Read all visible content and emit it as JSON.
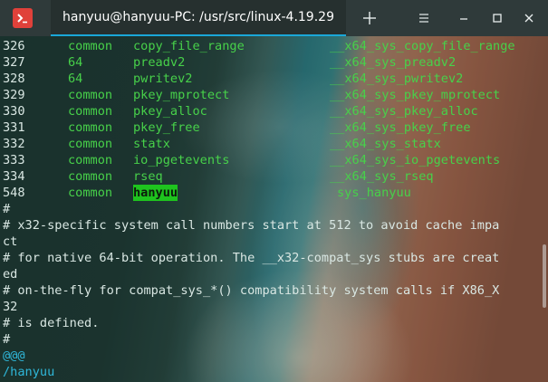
{
  "window": {
    "tab_title": "hanyuu@hanyuu-PC: /usr/src/linux-4.19.29",
    "new_tab_glyph": "+",
    "menu_glyph": "≡",
    "colors": {
      "titlebar": "#2f3a3a",
      "tab_underline": "#1aa7d8",
      "app_icon": "#e0413a"
    }
  },
  "table_rows": [
    {
      "num": "326",
      "abi": "common",
      "name": "copy_file_range",
      "entry": "__x64_sys_copy_file_range"
    },
    {
      "num": "327",
      "abi": "64",
      "name": "preadv2",
      "entry": "__x64_sys_preadv2"
    },
    {
      "num": "328",
      "abi": "64",
      "name": "pwritev2",
      "entry": "__x64_sys_pwritev2"
    },
    {
      "num": "329",
      "abi": "common",
      "name": "pkey_mprotect",
      "entry": "__x64_sys_pkey_mprotect"
    },
    {
      "num": "330",
      "abi": "common",
      "name": "pkey_alloc",
      "entry": "__x64_sys_pkey_alloc"
    },
    {
      "num": "331",
      "abi": "common",
      "name": "pkey_free",
      "entry": "__x64_sys_pkey_free"
    },
    {
      "num": "332",
      "abi": "common",
      "name": "statx",
      "entry": "__x64_sys_statx"
    },
    {
      "num": "333",
      "abi": "common",
      "name": "io_pgetevents",
      "entry": "__x64_sys_io_pgetevents"
    },
    {
      "num": "334",
      "abi": "common",
      "name": "rseq",
      "entry": "__x64_sys_rseq"
    },
    {
      "num": "548",
      "abi": "common",
      "name": "hanyuu",
      "entry": "sys_hanyuu"
    }
  ],
  "comment_lines": [
    "#",
    "# x32-specific system call numbers start at 512 to avoid cache impa",
    "ct",
    "# for native 64-bit operation. The __x32-compat_sys stubs are creat",
    "ed",
    "# on-the-fly for compat_sys_*() compatibility system calls if X86_X",
    "32",
    "# is defined.",
    "#"
  ],
  "vim_lines": [
    "@@@",
    "/hanyuu"
  ],
  "colors": {
    "syntax_green": "#47d14a",
    "text": "#d9e7e3",
    "cyan": "#2fb7d9",
    "search_highlight": "#1ec31e"
  }
}
